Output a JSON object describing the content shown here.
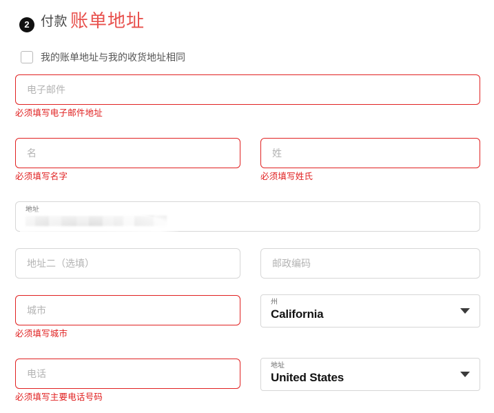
{
  "header": {
    "step_number": "2",
    "step_title": "付款",
    "step_subtitle": "账单地址",
    "accent_red": "#e8514d",
    "error_red": "#e02020",
    "badge_bg": "#111111"
  },
  "same_address_checkbox": {
    "label": "我的账单地址与我的收货地址相同",
    "checked": false
  },
  "fields": {
    "email": {
      "placeholder": "电子邮件",
      "value": "",
      "error": "必须填写电子邮件地址",
      "has_error": true
    },
    "first_name": {
      "placeholder": "名",
      "value": "",
      "error": "必须填写名字",
      "has_error": true
    },
    "last_name": {
      "placeholder": "姓",
      "value": "",
      "error": "必须填写姓氏",
      "has_error": true
    },
    "address1": {
      "label": "地址",
      "value": "",
      "redacted": true,
      "has_error": false
    },
    "address2": {
      "placeholder": "地址二（选填）",
      "value": "",
      "has_error": false
    },
    "postal_code": {
      "placeholder": "邮政编码",
      "value": "",
      "has_error": false
    },
    "city": {
      "placeholder": "城市",
      "value": "",
      "error": "必须填写城市",
      "has_error": true
    },
    "state": {
      "label": "州",
      "value": "California",
      "icon": "chevron-down-icon"
    },
    "phone": {
      "placeholder": "电话",
      "value": "",
      "error": "必须填写主要电话号码",
      "has_error": true
    },
    "country": {
      "label": "地址",
      "value": "United States",
      "icon": "chevron-down-icon"
    }
  }
}
